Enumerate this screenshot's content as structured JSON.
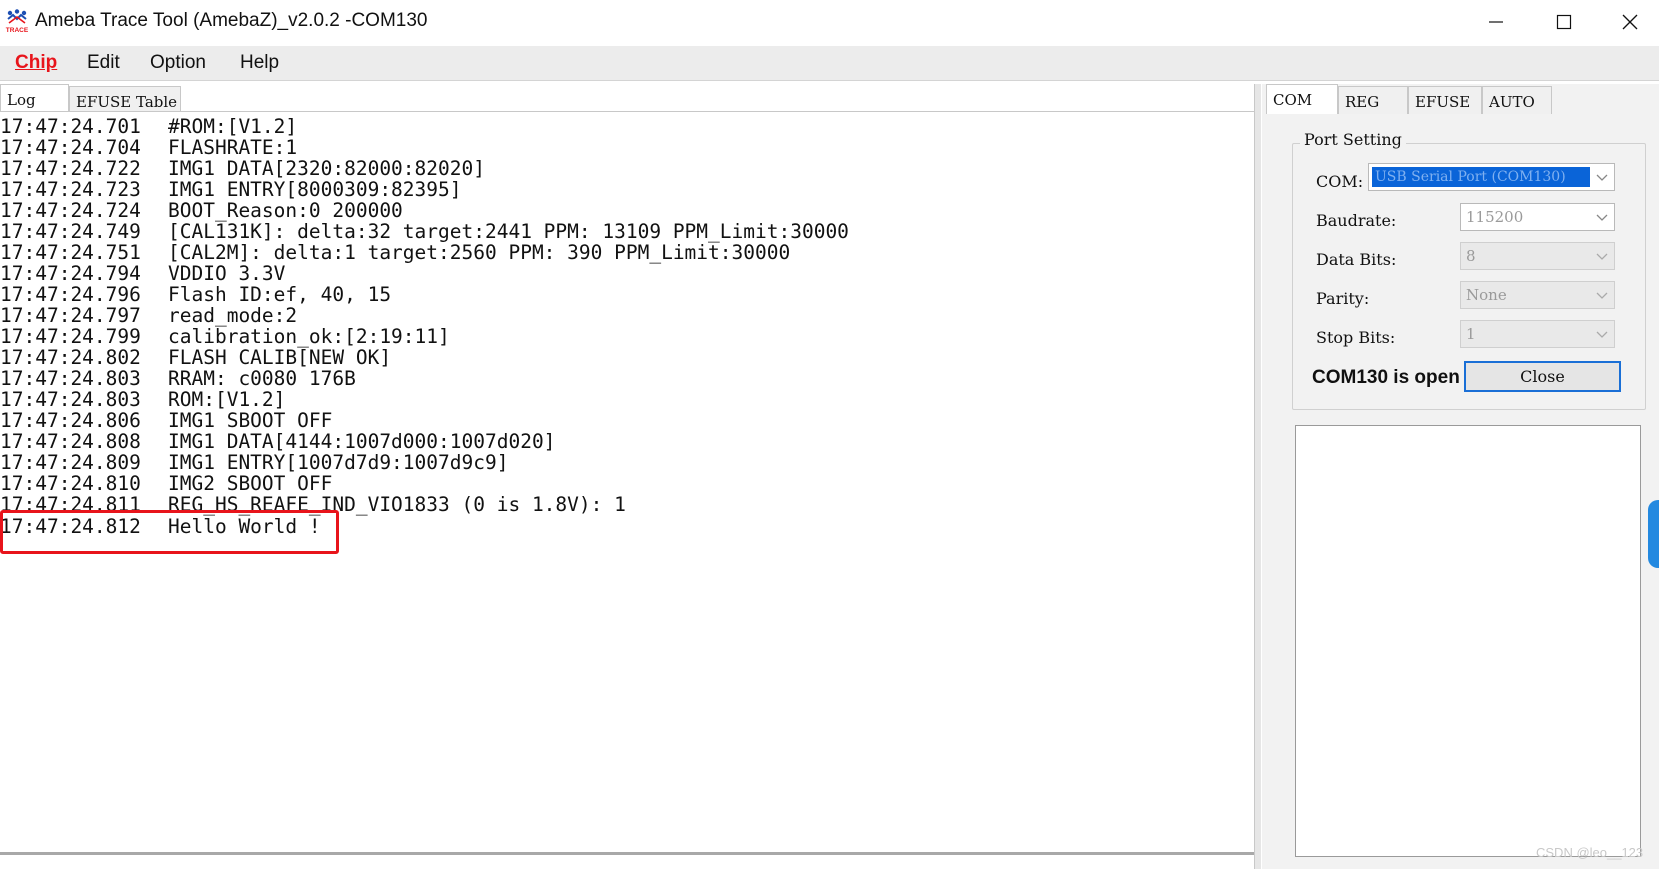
{
  "window": {
    "title": "Ameba Trace Tool (AmebaZ)_v2.0.2 -COM130",
    "icon_name": "ameba-trace-icon",
    "icon_text": "TRACE"
  },
  "menu": {
    "chip": "Chip",
    "edit": "Edit",
    "option": "Option",
    "help": "Help"
  },
  "left_tabs": {
    "log": "Log",
    "efuse_table": "EFUSE Table"
  },
  "right_tabs": {
    "com": "COM",
    "reg": "REG",
    "efuse": "EFUSE",
    "auto": "AUTO"
  },
  "log": {
    "lines": [
      {
        "time": "17:47:24.701",
        "msg": "#ROM:[V1.2]"
      },
      {
        "time": "17:47:24.704",
        "msg": "FLASHRATE:1"
      },
      {
        "time": "17:47:24.722",
        "msg": "IMG1 DATA[2320:82000:82020]"
      },
      {
        "time": "17:47:24.723",
        "msg": "IMG1 ENTRY[8000309:82395]"
      },
      {
        "time": "17:47:24.724",
        "msg": "BOOT_Reason:0 200000"
      },
      {
        "time": "17:47:24.749",
        "msg": "[CAL131K]: delta:32 target:2441 PPM: 13109 PPM_Limit:30000"
      },
      {
        "time": "17:47:24.751",
        "msg": "[CAL2M]: delta:1 target:2560 PPM: 390 PPM_Limit:30000"
      },
      {
        "time": "17:47:24.794",
        "msg": "VDDIO 3.3V"
      },
      {
        "time": "17:47:24.796",
        "msg": "Flash ID:ef, 40, 15"
      },
      {
        "time": "17:47:24.797",
        "msg": "read_mode:2"
      },
      {
        "time": "17:47:24.799",
        "msg": "calibration_ok:[2:19:11]"
      },
      {
        "time": "17:47:24.802",
        "msg": "FLASH CALIB[NEW OK]"
      },
      {
        "time": "17:47:24.803",
        "msg": "RRAM: c0080 176B"
      },
      {
        "time": "17:47:24.803",
        "msg": "ROM:[V1.2]"
      },
      {
        "time": "17:47:24.806",
        "msg": "IMG1 SBOOT OFF"
      },
      {
        "time": "17:47:24.808",
        "msg": "IMG1 DATA[4144:1007d000:1007d020]"
      },
      {
        "time": "17:47:24.809",
        "msg": "IMG1 ENTRY[1007d7d9:1007d9c9]"
      },
      {
        "time": "17:47:24.810",
        "msg": "IMG2 SBOOT OFF"
      },
      {
        "time": "17:47:24.811",
        "msg": "REG_HS_REAFE_IND_VIO1833 (0 is 1.8V): 1"
      },
      {
        "time": "17:47:24.812",
        "msg": "Hello World !"
      }
    ],
    "highlight_color": "#e8141b"
  },
  "port_setting": {
    "title": "Port Setting",
    "com_label": "COM:",
    "com_value": "USB Serial Port (COM130)",
    "baudrate_label": "Baudrate:",
    "baudrate_value": "115200",
    "databits_label": "Data Bits:",
    "databits_value": "8",
    "parity_label": "Parity:",
    "parity_value": "None",
    "stopbits_label": "Stop Bits:",
    "stopbits_value": "1",
    "status": "COM130 is open",
    "close_label": "Close"
  },
  "watermark": "CSDN @leo__123",
  "colors": {
    "accent_red": "#e8141b",
    "selection_blue": "#0a64d8",
    "button_border": "#1a6fd6"
  }
}
